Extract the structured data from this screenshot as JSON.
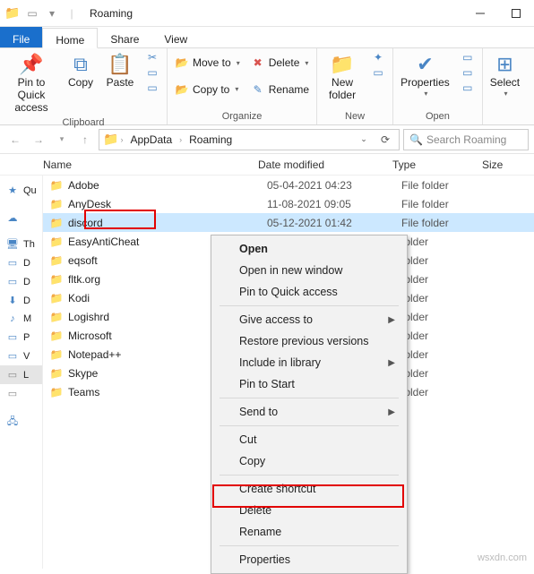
{
  "window": {
    "title": "Roaming"
  },
  "tabs": {
    "file": "File",
    "home": "Home",
    "share": "Share",
    "view": "View"
  },
  "ribbon": {
    "clipboard": {
      "label": "Clipboard",
      "pin": "Pin to Quick access",
      "copy": "Copy",
      "paste": "Paste",
      "cut": "Cut"
    },
    "organize": {
      "label": "Organize",
      "moveto": "Move to",
      "copyto": "Copy to",
      "delete": "Delete",
      "rename": "Rename"
    },
    "new": {
      "label": "New",
      "newfolder": "New folder"
    },
    "open": {
      "label": "Open",
      "properties": "Properties"
    },
    "select": {
      "label": "Select"
    }
  },
  "address": {
    "crumbs": [
      "AppData",
      "Roaming"
    ],
    "search_placeholder": "Search Roaming"
  },
  "columns": {
    "name": "Name",
    "date": "Date modified",
    "type": "Type",
    "size": "Size"
  },
  "sidebar": {
    "qa": "Qu",
    "th": "Th"
  },
  "files": [
    {
      "name": "Adobe",
      "date": "05-04-2021 04:23",
      "type": "File folder"
    },
    {
      "name": "AnyDesk",
      "date": "11-08-2021 09:05",
      "type": "File folder"
    },
    {
      "name": "discord",
      "date": "05-12-2021 01:42",
      "type": "File folder",
      "selected": true
    },
    {
      "name": "EasyAntiCheat",
      "date": "",
      "type": "folder"
    },
    {
      "name": "eqsoft",
      "date": "",
      "type": "folder"
    },
    {
      "name": "fltk.org",
      "date": "",
      "type": "folder"
    },
    {
      "name": "Kodi",
      "date": "",
      "type": "folder"
    },
    {
      "name": "Logishrd",
      "date": "",
      "type": "folder"
    },
    {
      "name": "Microsoft",
      "date": "",
      "type": "folder"
    },
    {
      "name": "Notepad++",
      "date": "",
      "type": "folder"
    },
    {
      "name": "Skype",
      "date": "",
      "type": "folder"
    },
    {
      "name": "Teams",
      "date": "",
      "type": "folder"
    }
  ],
  "context_menu": [
    {
      "label": "Open",
      "bold": true
    },
    {
      "label": "Open in new window"
    },
    {
      "label": "Pin to Quick access"
    },
    {
      "sep": true
    },
    {
      "label": "Give access to",
      "sub": true
    },
    {
      "label": "Restore previous versions"
    },
    {
      "label": "Include in library",
      "sub": true
    },
    {
      "label": "Pin to Start"
    },
    {
      "sep": true
    },
    {
      "label": "Send to",
      "sub": true
    },
    {
      "sep": true
    },
    {
      "label": "Cut"
    },
    {
      "label": "Copy"
    },
    {
      "sep": true
    },
    {
      "label": "Create shortcut"
    },
    {
      "label": "Delete"
    },
    {
      "label": "Rename"
    },
    {
      "sep": true
    },
    {
      "label": "Properties"
    }
  ],
  "watermark": "wsxdn.com"
}
